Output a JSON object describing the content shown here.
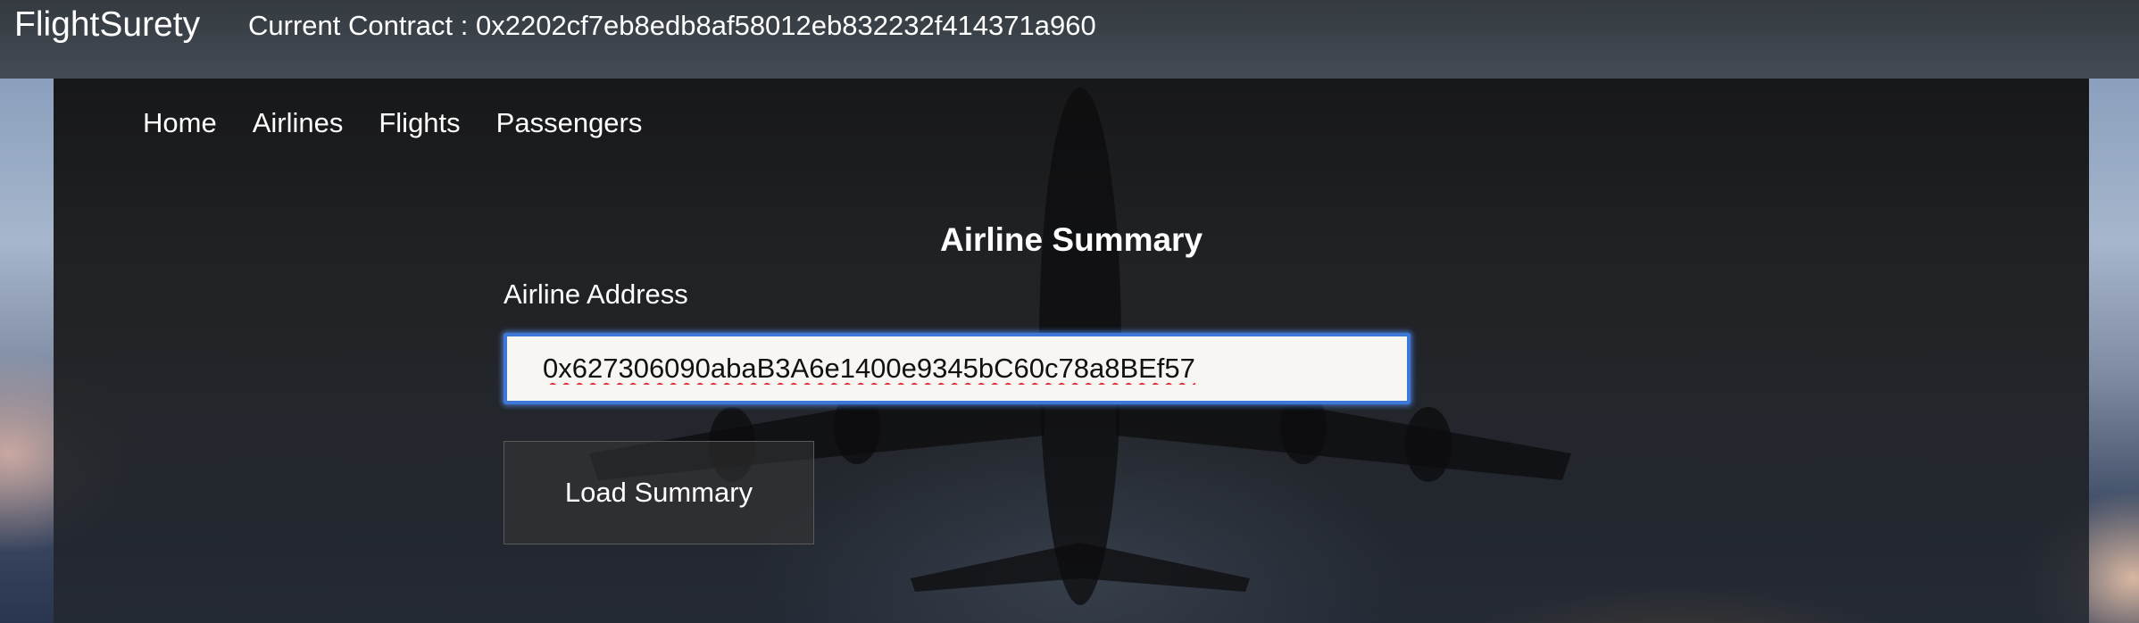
{
  "navbar": {
    "brand": "FlightSurety",
    "contract_text": "Current Contract : 0x2202cf7eb8edb8af58012eb832232f414371a960"
  },
  "subnav": {
    "items": [
      {
        "label": "Home"
      },
      {
        "label": "Airlines"
      },
      {
        "label": "Flights"
      },
      {
        "label": "Passengers"
      }
    ]
  },
  "main": {
    "title": "Airline Summary",
    "address_label": "Airline Address",
    "address_value": "0x627306090abaB3A6e1400e9345bC60c78a8BEf57",
    "load_button_label": "Load Summary"
  },
  "colors": {
    "navbar_bg": "#343a40",
    "input_focus_border": "#3d78d8",
    "text": "#ffffff"
  }
}
